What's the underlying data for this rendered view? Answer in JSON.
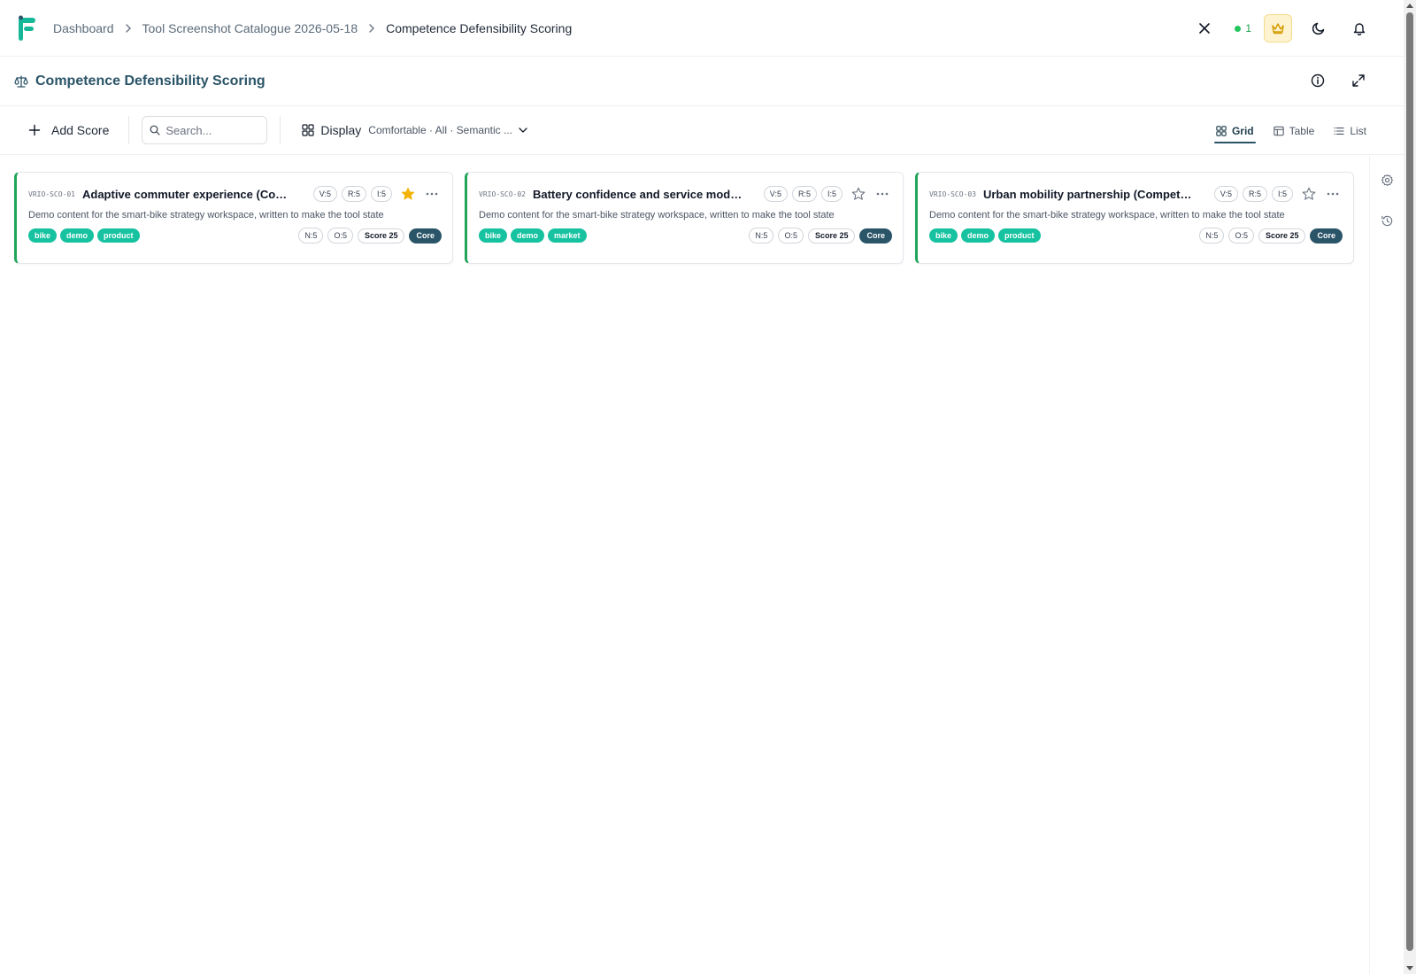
{
  "breadcrumb": {
    "items": [
      "Dashboard",
      "Tool Screenshot Catalogue 2026-05-18",
      "Competence Defensibility Scoring"
    ]
  },
  "header": {
    "online_count": "1",
    "icons": [
      "close-icon",
      "crown-icon",
      "moon-icon",
      "bell-icon"
    ]
  },
  "page": {
    "title": "Competence Defensibility Scoring",
    "icon": "scale-icon"
  },
  "toolbar": {
    "add_label": "Add Score",
    "search_placeholder": "Search...",
    "display_label": "Display",
    "display_summary": "Comfortable · All · Semantic ...",
    "views": [
      "Grid",
      "Table",
      "List"
    ],
    "active_view": "Grid"
  },
  "cards": [
    {
      "id": "VRIO-SCO-01",
      "title": "Adaptive commuter experience (Competence)",
      "v": "V:5",
      "r": "R:5",
      "i": "I:5",
      "starred": true,
      "description": "Demo content for the smart-bike strategy workspace, written to make the tool state",
      "tags": [
        "bike",
        "demo",
        "product"
      ],
      "n": "N:5",
      "o": "O:5",
      "score": "Score 25",
      "status": "Core"
    },
    {
      "id": "VRIO-SCO-02",
      "title": "Battery confidence and service model (Competence)",
      "v": "V:5",
      "r": "R:5",
      "i": "I:5",
      "starred": false,
      "description": "Demo content for the smart-bike strategy workspace, written to make the tool state",
      "tags": [
        "bike",
        "demo",
        "market"
      ],
      "n": "N:5",
      "o": "O:5",
      "score": "Score 25",
      "status": "Core"
    },
    {
      "id": "VRIO-SCO-03",
      "title": "Urban mobility partnership (Competence)",
      "v": "V:5",
      "r": "R:5",
      "i": "I:5",
      "starred": false,
      "description": "Demo content for the smart-bike strategy workspace, written to make the tool state",
      "tags": [
        "bike",
        "demo",
        "product"
      ],
      "n": "N:5",
      "o": "O:5",
      "score": "Score 25",
      "status": "Core"
    }
  ],
  "colors": {
    "accent": "#2a5468",
    "tag": "#16c2a0",
    "card_border": "#22a55b",
    "star": "#f5b301"
  }
}
